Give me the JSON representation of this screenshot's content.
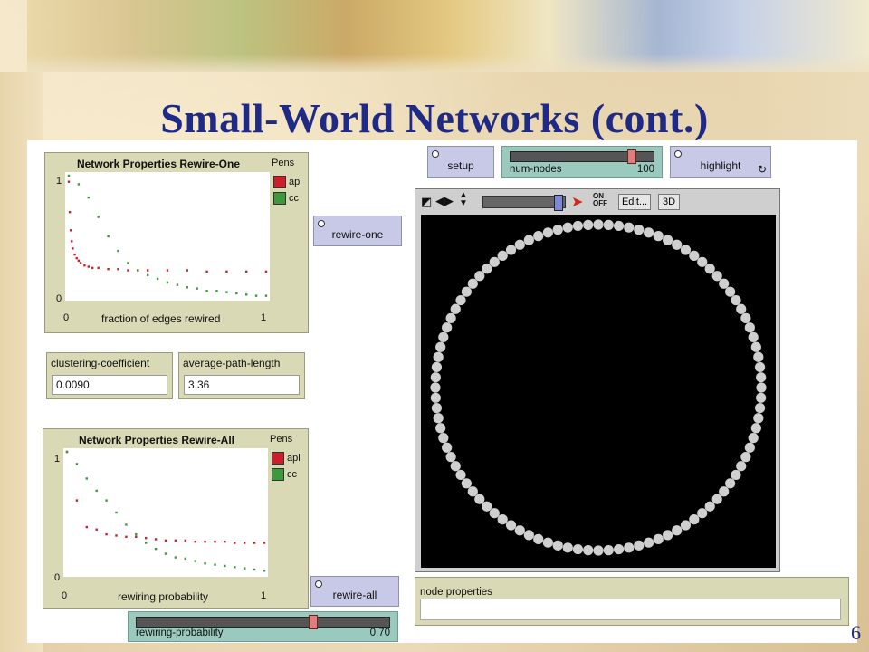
{
  "slide": {
    "title": "Small-World Networks (cont.)",
    "number": "6"
  },
  "buttons": {
    "setup": "setup",
    "highlight": "highlight",
    "rewire_one": "rewire-one",
    "rewire_all": "rewire-all"
  },
  "sliders": {
    "num_nodes": {
      "name": "num-nodes",
      "value": "100",
      "fraction": 0.86
    },
    "rewiring_probability": {
      "name": "rewiring-probability",
      "value": "0.70",
      "fraction": 0.7
    }
  },
  "monitors": {
    "clustering_coefficient": {
      "label": "clustering-coefficient",
      "value": "0.0090"
    },
    "average_path_length": {
      "label": "average-path-length",
      "value": "3.36"
    }
  },
  "view": {
    "edit_label": "Edit...",
    "three_d_label": "3D",
    "on_label": "ON",
    "off_label": "OFF",
    "node_count": 100,
    "node_color": "#cfcfcf"
  },
  "node_properties": {
    "label": "node properties"
  },
  "colors": {
    "apl": "#cc1f2b",
    "cc": "#3c9a3a",
    "slider_bg": "#9ac9bd",
    "button_bg": "#c7c9e6",
    "widget_bg": "#d9d9b5",
    "title": "#1f2a86"
  },
  "chart_data": [
    {
      "type": "scatter",
      "title": "Network Properties Rewire-One",
      "xlabel": "fraction of edges rewired",
      "xlim": [
        0,
        1
      ],
      "ylim": [
        0,
        1
      ],
      "x_ticks": [
        "0",
        "1"
      ],
      "y_ticks": [
        "0",
        "1"
      ],
      "pens_label": "Pens",
      "series": [
        {
          "name": "apl",
          "color": "#cc1f2b",
          "x": [
            0.0,
            0.005,
            0.01,
            0.015,
            0.02,
            0.03,
            0.04,
            0.05,
            0.06,
            0.08,
            0.1,
            0.12,
            0.15,
            0.2,
            0.25,
            0.3,
            0.35,
            0.4,
            0.5,
            0.6,
            0.7,
            0.8,
            0.9,
            1.0
          ],
          "y": [
            0.95,
            0.7,
            0.55,
            0.46,
            0.4,
            0.35,
            0.32,
            0.3,
            0.28,
            0.26,
            0.25,
            0.24,
            0.24,
            0.23,
            0.23,
            0.22,
            0.22,
            0.22,
            0.22,
            0.22,
            0.21,
            0.21,
            0.21,
            0.21
          ]
        },
        {
          "name": "cc",
          "color": "#3c9a3a",
          "x": [
            0.0,
            0.05,
            0.1,
            0.15,
            0.2,
            0.25,
            0.3,
            0.35,
            0.4,
            0.45,
            0.5,
            0.55,
            0.6,
            0.65,
            0.7,
            0.75,
            0.8,
            0.85,
            0.9,
            0.95,
            1.0
          ],
          "y": [
            1.0,
            0.93,
            0.82,
            0.66,
            0.5,
            0.38,
            0.28,
            0.22,
            0.18,
            0.15,
            0.12,
            0.1,
            0.08,
            0.07,
            0.05,
            0.05,
            0.04,
            0.03,
            0.02,
            0.01,
            0.01
          ]
        }
      ]
    },
    {
      "type": "scatter",
      "title": "Network Properties Rewire-All",
      "xlabel": "rewiring probability",
      "xlim": [
        0,
        1
      ],
      "ylim": [
        0,
        1
      ],
      "x_ticks": [
        "0",
        "1"
      ],
      "y_ticks": [
        "0",
        "1"
      ],
      "pens_label": "Pens",
      "series": [
        {
          "name": "apl",
          "color": "#cc1f2b",
          "x": [
            0.0,
            0.05,
            0.1,
            0.15,
            0.2,
            0.25,
            0.3,
            0.35,
            0.4,
            0.45,
            0.5,
            0.55,
            0.6,
            0.65,
            0.7,
            0.75,
            0.8,
            0.85,
            0.9,
            0.95,
            1.0
          ],
          "y": [
            1.0,
            0.6,
            0.38,
            0.36,
            0.32,
            0.31,
            0.3,
            0.3,
            0.29,
            0.28,
            0.27,
            0.27,
            0.27,
            0.26,
            0.26,
            0.26,
            0.26,
            0.25,
            0.25,
            0.25,
            0.25
          ]
        },
        {
          "name": "cc",
          "color": "#3c9a3a",
          "x": [
            0.0,
            0.05,
            0.1,
            0.15,
            0.2,
            0.25,
            0.3,
            0.35,
            0.4,
            0.45,
            0.5,
            0.55,
            0.6,
            0.65,
            0.7,
            0.75,
            0.8,
            0.85,
            0.9,
            0.95,
            1.0
          ],
          "y": [
            1.0,
            0.9,
            0.78,
            0.68,
            0.6,
            0.5,
            0.4,
            0.32,
            0.25,
            0.2,
            0.16,
            0.13,
            0.12,
            0.1,
            0.08,
            0.07,
            0.06,
            0.05,
            0.04,
            0.03,
            0.02
          ]
        }
      ]
    }
  ]
}
